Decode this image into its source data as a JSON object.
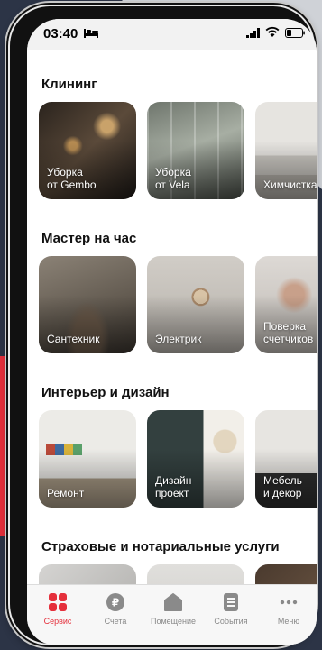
{
  "status_bar": {
    "time": "03:40"
  },
  "sections": [
    {
      "title": "Клининг",
      "cards": [
        {
          "label": "Уборка\nот Gembo"
        },
        {
          "label": "Уборка\nот Vela"
        },
        {
          "label": "Химчистка"
        }
      ]
    },
    {
      "title": "Мастер на час",
      "cards": [
        {
          "label": "Сантехник"
        },
        {
          "label": "Электрик"
        },
        {
          "label": "Поверка\nсчетчиков"
        }
      ]
    },
    {
      "title": "Интерьер и дизайн",
      "cards": [
        {
          "label": "Ремонт"
        },
        {
          "label": "Дизайн\nпроект"
        },
        {
          "label": "Мебель\nи декор"
        }
      ]
    },
    {
      "title": "Страховые и нотариальные услуги",
      "cards": [
        {
          "label": ""
        },
        {
          "label": ""
        },
        {
          "label": ""
        }
      ]
    }
  ],
  "tabbar": {
    "active_color": "#e5303c",
    "items": [
      {
        "label": "Сервис",
        "icon": "grid-icon"
      },
      {
        "label": "Счета",
        "icon": "ruble-icon"
      },
      {
        "label": "Помещение",
        "icon": "house-icon"
      },
      {
        "label": "События",
        "icon": "document-icon"
      },
      {
        "label": "Меню",
        "icon": "more-icon"
      }
    ]
  }
}
